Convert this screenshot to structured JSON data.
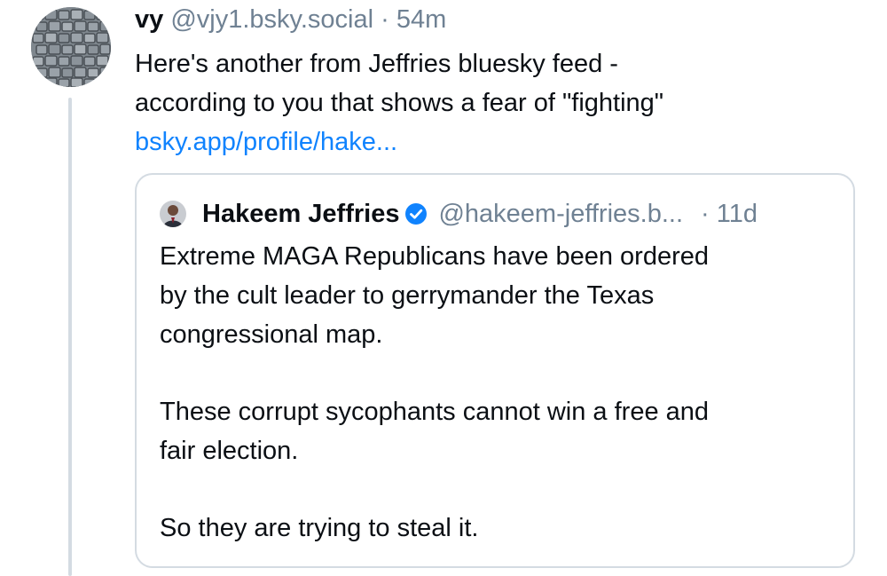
{
  "post": {
    "author_name": "vy",
    "handle": "@vjy1.bsky.social",
    "separator": "·",
    "time": "54m",
    "avatar_icon": "cobblestone-avatar",
    "text_lines": [
      "Here's another from Jeffries bluesky feed -",
      "according to you that shows a fear of \"fighting\""
    ],
    "link_text": "bsky.app/profile/hake..."
  },
  "quote": {
    "author_name": "Hakeem Jeffries",
    "verified_icon": "verified-check-icon",
    "handle": "@hakeem-jeffries.b...",
    "time": "· 11d",
    "paragraphs": [
      [
        "Extreme MAGA Republicans have been ordered",
        "by the cult leader to gerrymander the Texas",
        "congressional map."
      ],
      [
        "These corrupt sycophants cannot win a free and",
        "fair election."
      ],
      [
        "So they are trying to steal it."
      ]
    ]
  },
  "colors": {
    "text": "#0b0f14",
    "muted": "#6f8193",
    "link": "#1083fe",
    "border": "#d4dbe2",
    "verified": "#1083fe"
  }
}
